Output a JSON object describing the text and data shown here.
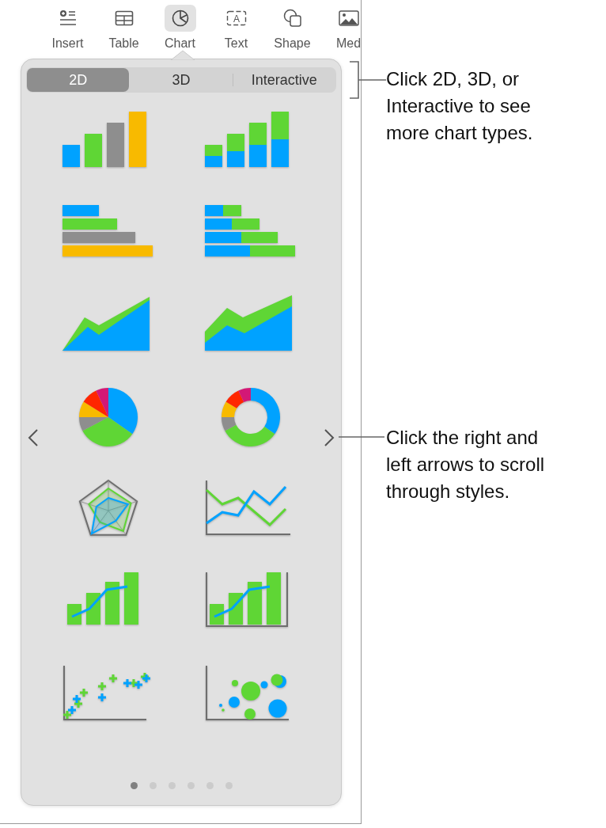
{
  "toolbar": {
    "items": [
      {
        "kind": "insert",
        "label": "Insert",
        "selected": false
      },
      {
        "kind": "table",
        "label": "Table",
        "selected": false
      },
      {
        "kind": "chart",
        "label": "Chart",
        "selected": true
      },
      {
        "kind": "text",
        "label": "Text",
        "glyph": "A",
        "selected": false
      },
      {
        "kind": "shape",
        "label": "Shape",
        "selected": false
      },
      {
        "kind": "media",
        "label": "Med",
        "selected": false
      }
    ]
  },
  "popover": {
    "segments": [
      {
        "label": "2D",
        "selected": true
      },
      {
        "label": "3D",
        "selected": false
      },
      {
        "label": "Interactive",
        "selected": false
      }
    ],
    "chart_styles": [
      {
        "kind": "column"
      },
      {
        "kind": "stacked-column"
      },
      {
        "kind": "bar"
      },
      {
        "kind": "stacked-bar"
      },
      {
        "kind": "area"
      },
      {
        "kind": "stacked-area"
      },
      {
        "kind": "pie"
      },
      {
        "kind": "donut"
      },
      {
        "kind": "radar"
      },
      {
        "kind": "line"
      },
      {
        "kind": "mixed"
      },
      {
        "kind": "two-axis"
      },
      {
        "kind": "scatter"
      },
      {
        "kind": "bubble"
      }
    ],
    "pages": [
      {
        "selected": true
      },
      {
        "selected": false
      },
      {
        "selected": false
      },
      {
        "selected": false
      },
      {
        "selected": false
      },
      {
        "selected": false
      }
    ]
  },
  "callouts": [
    {
      "text": "Click 2D, 3D, or Interactive to see more chart types."
    },
    {
      "text": "Click the right and left arrows to scroll through styles."
    }
  ]
}
